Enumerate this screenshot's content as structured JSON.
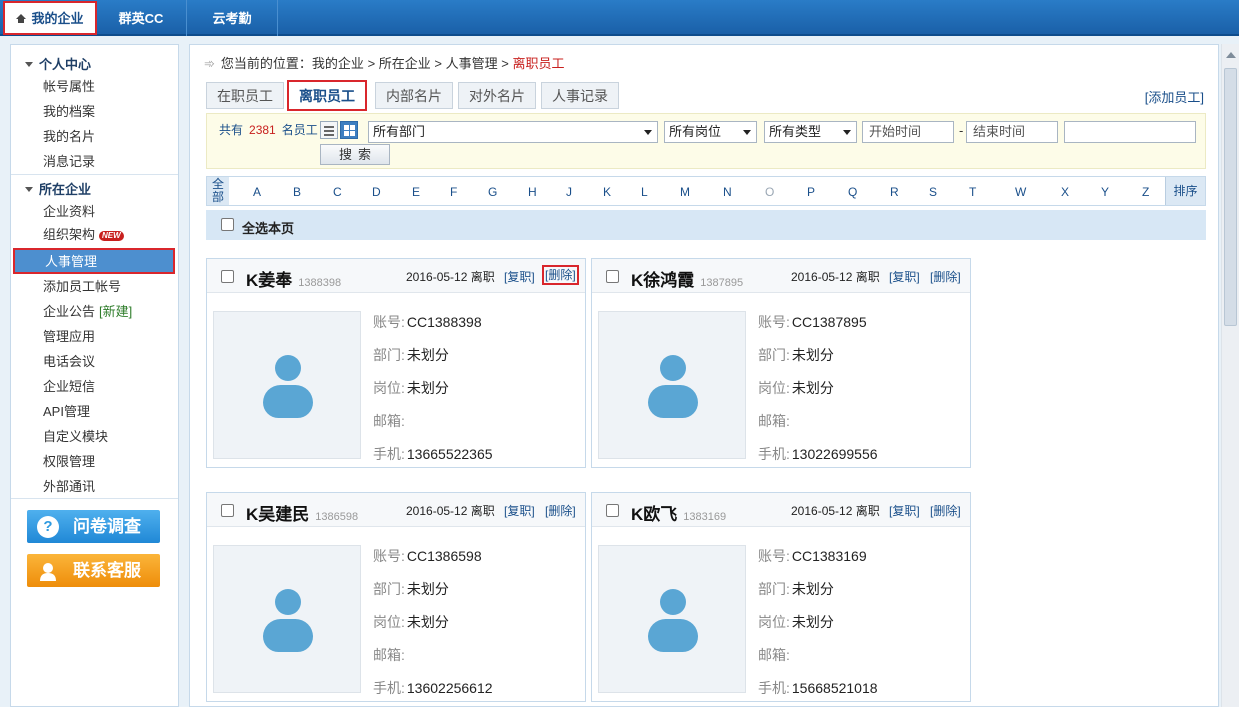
{
  "topnav": {
    "tabs": [
      {
        "label": "我的企业",
        "icon": "home-icon"
      },
      {
        "label": "群英CC"
      },
      {
        "label": "云考勤"
      }
    ]
  },
  "sidebar": {
    "section1": "个人中心",
    "items1": [
      "帐号属性",
      "我的档案",
      "我的名片",
      "消息记录"
    ],
    "section2": "所在企业",
    "items2": [
      "企业资料",
      "组织架构",
      "人事管理",
      "添加员工帐号",
      "企业公告",
      "管理应用",
      "电话会议",
      "企业短信",
      "API管理",
      "自定义模块",
      "权限管理",
      "外部通讯"
    ],
    "new_badge": "NEW",
    "new_link": "[新建]",
    "survey_button": "问卷调查",
    "service_button": "联系客服",
    "survey_icon": "?",
    "colors": {
      "survey": "#2e9ae0",
      "service": "#f39a12",
      "active": "#4d8fcf",
      "highlight": "#d9262c"
    }
  },
  "breadcrumb": {
    "prefix": "您当前的位置：",
    "items": [
      "我的企业",
      "所在企业",
      "人事管理"
    ],
    "current": "离职员工",
    "sep": ">"
  },
  "tabs": [
    "在职员工",
    "离职员工",
    "内部名片",
    "对外名片",
    "人事记录"
  ],
  "add_employee": "[添加员工]",
  "filter": {
    "total_prefix": "共有",
    "total_count": "2381",
    "total_suffix": "名员工",
    "department": "所有部门",
    "position": "所有岗位",
    "type": "所有类型",
    "start_placeholder": "开始时间",
    "end_placeholder": "结束时间",
    "search_button": "搜索"
  },
  "alphabet": {
    "all": "全部",
    "letters": [
      "A",
      "B",
      "C",
      "D",
      "E",
      "F",
      "G",
      "H",
      "J",
      "K",
      "L",
      "M",
      "N",
      "O",
      "P",
      "Q",
      "R",
      "S",
      "T",
      "W",
      "X",
      "Y",
      "Z"
    ],
    "sort": "排序"
  },
  "select_all": "全选本页",
  "labels": {
    "account": "账号:",
    "dept": "部门:",
    "post": "岗位:",
    "email": "邮箱:",
    "mobile": "手机:"
  },
  "cards": [
    {
      "name": "K姜奉",
      "id": "1388398",
      "date": "2016-05-12",
      "status": "离职",
      "reinstate": "[复职]",
      "delete": "[删除]",
      "account": "CC1388398",
      "dept": "未划分",
      "post": "未划分",
      "email": "",
      "mobile": "13665522365"
    },
    {
      "name": "K徐鸿霞",
      "id": "1387895",
      "date": "2016-05-12",
      "status": "离职",
      "reinstate": "[复职]",
      "delete": "[删除]",
      "account": "CC1387895",
      "dept": "未划分",
      "post": "未划分",
      "email": "",
      "mobile": "13022699556"
    },
    {
      "name": "K吴建民",
      "id": "1386598",
      "date": "2016-05-12",
      "status": "离职",
      "reinstate": "[复职]",
      "delete": "[删除]",
      "account": "CC1386598",
      "dept": "未划分",
      "post": "未划分",
      "email": "",
      "mobile": "13602256612"
    },
    {
      "name": "K欧飞",
      "id": "1383169",
      "date": "2016-05-12",
      "status": "离职",
      "reinstate": "[复职]",
      "delete": "[删除]",
      "account": "CC1383169",
      "dept": "未划分",
      "post": "未划分",
      "email": "",
      "mobile": "15668521018"
    }
  ]
}
